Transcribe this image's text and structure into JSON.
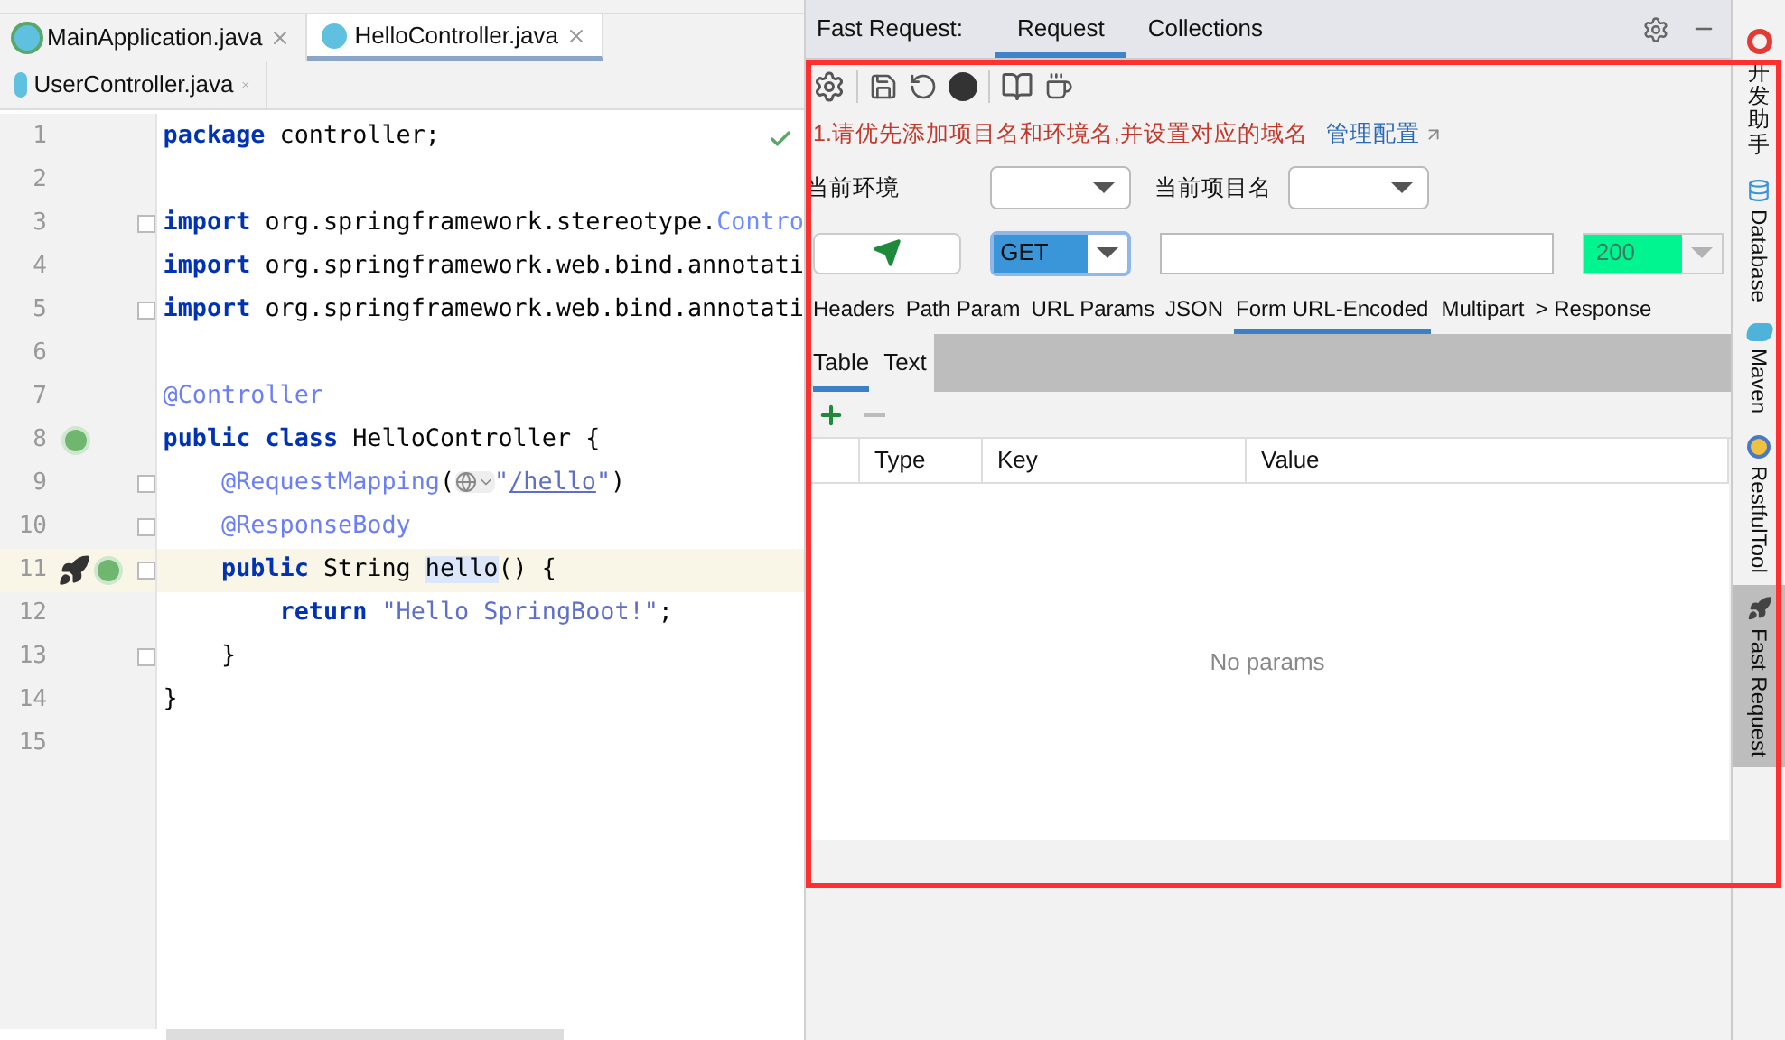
{
  "editor": {
    "tabs": [
      {
        "label": "MainApplication.java",
        "kind": "main",
        "selected": false
      },
      {
        "label": "HelloController.java",
        "kind": "class",
        "selected": true
      },
      {
        "label": "UserController.java",
        "kind": "class",
        "selected": false
      }
    ],
    "lines": [
      {
        "number": "1",
        "kind": "plain",
        "fold": false,
        "current": false,
        "tokens": [
          {
            "kind": "keyword",
            "text": "package"
          },
          {
            "kind": "plain",
            "text": " controller;"
          }
        ]
      },
      {
        "number": "2",
        "kind": "plain",
        "fold": false,
        "current": false
      },
      {
        "number": "3",
        "kind": "plain",
        "fold": true,
        "current": false,
        "tokens": [
          {
            "kind": "keyword",
            "text": "import"
          },
          {
            "kind": "plain",
            "text": " org.springframework.stereotype."
          },
          {
            "kind": "type",
            "text": "Contro"
          }
        ]
      },
      {
        "number": "4",
        "kind": "plain",
        "fold": false,
        "current": false,
        "tokens": [
          {
            "kind": "keyword",
            "text": "import"
          },
          {
            "kind": "plain",
            "text": " org.springframework.web.bind.annotati"
          }
        ]
      },
      {
        "number": "5",
        "kind": "plain",
        "fold": true,
        "current": false,
        "tokens": [
          {
            "kind": "keyword",
            "text": "import"
          },
          {
            "kind": "plain",
            "text": " org.springframework.web.bind.annotati"
          }
        ]
      },
      {
        "number": "6",
        "kind": "plain",
        "fold": false,
        "current": false
      },
      {
        "number": "7",
        "kind": "plain",
        "fold": false,
        "current": false,
        "tokens": [
          {
            "kind": "annotation",
            "text": "@Controller"
          }
        ]
      },
      {
        "number": "8",
        "kind": "bean",
        "fold": false,
        "current": false,
        "tokens": [
          {
            "kind": "keyword",
            "text": "public class"
          },
          {
            "kind": "plain",
            "text": " HelloController {"
          }
        ]
      },
      {
        "number": "9",
        "kind": "plain",
        "fold": true,
        "current": false,
        "tokens": [
          {
            "kind": "annotation",
            "text": "    @RequestMapping"
          },
          {
            "kind": "plain",
            "text": "("
          },
          {
            "kind": "globe"
          },
          {
            "kind": "string",
            "text": "\""
          },
          {
            "kind": "link",
            "text": "/hello"
          },
          {
            "kind": "string",
            "text": "\""
          },
          {
            "kind": "plain",
            "text": ")"
          }
        ]
      },
      {
        "number": "10",
        "kind": "plain",
        "fold": true,
        "current": false,
        "tokens": [
          {
            "kind": "annotation",
            "text": "    @ResponseBody"
          }
        ]
      },
      {
        "number": "11",
        "kind": "rocket",
        "fold": true,
        "current": true,
        "tokens": [
          {
            "kind": "keyword",
            "text": "    public"
          },
          {
            "kind": "plain",
            "text": " String "
          },
          {
            "kind": "highlight",
            "text": "hello"
          },
          {
            "kind": "plain",
            "text": "() {"
          }
        ]
      },
      {
        "number": "12",
        "kind": "plain",
        "fold": false,
        "current": false,
        "tokens": [
          {
            "kind": "keyword",
            "text": "        return"
          },
          {
            "kind": "string",
            "text": " \"Hello SpringBoot!\""
          },
          {
            "kind": "plain",
            "text": ";"
          }
        ]
      },
      {
        "number": "13",
        "kind": "plain",
        "fold": true,
        "current": false,
        "tokens": [
          {
            "kind": "plain",
            "text": "    }"
          }
        ]
      },
      {
        "number": "14",
        "kind": "plain",
        "fold": false,
        "current": false,
        "tokens": [
          {
            "kind": "plain",
            "text": "}"
          }
        ]
      },
      {
        "number": "15",
        "kind": "plain",
        "fold": false,
        "current": false
      }
    ]
  },
  "panel": {
    "title": "Fast Request:",
    "tabs": [
      {
        "label": "Request",
        "selected": true
      },
      {
        "label": "Collections",
        "selected": false
      }
    ],
    "warning": "1.请优先添加项目名和环境名,并设置对应的域名",
    "config_link": "管理配置",
    "env_label": "当前环境",
    "project_label": "当前项目名",
    "method": "GET",
    "status": "200",
    "request_tabs": [
      {
        "label": "Headers",
        "selected": false
      },
      {
        "label": "Path Param",
        "selected": false
      },
      {
        "label": "URL Params",
        "selected": false
      },
      {
        "label": "JSON",
        "selected": false
      },
      {
        "label": "Form URL-Encoded",
        "selected": true
      },
      {
        "label": "Multipart",
        "selected": false
      },
      {
        "label": "> Response",
        "selected": false
      }
    ],
    "view_tabs": [
      {
        "label": "Table",
        "selected": true
      },
      {
        "label": "Text",
        "selected": false
      }
    ],
    "columns": [
      "Type",
      "Key",
      "Value"
    ],
    "empty": "No params"
  },
  "sidebar": [
    {
      "label": "开发助手",
      "kind": "cjk",
      "selected": false
    },
    {
      "label": "Database",
      "kind": "latin",
      "selected": false
    },
    {
      "label": "Maven",
      "kind": "latin",
      "selected": false
    },
    {
      "label": "RestfulTool",
      "kind": "latin",
      "selected": false
    },
    {
      "label": "Fast Request",
      "kind": "latin",
      "selected": true
    }
  ]
}
